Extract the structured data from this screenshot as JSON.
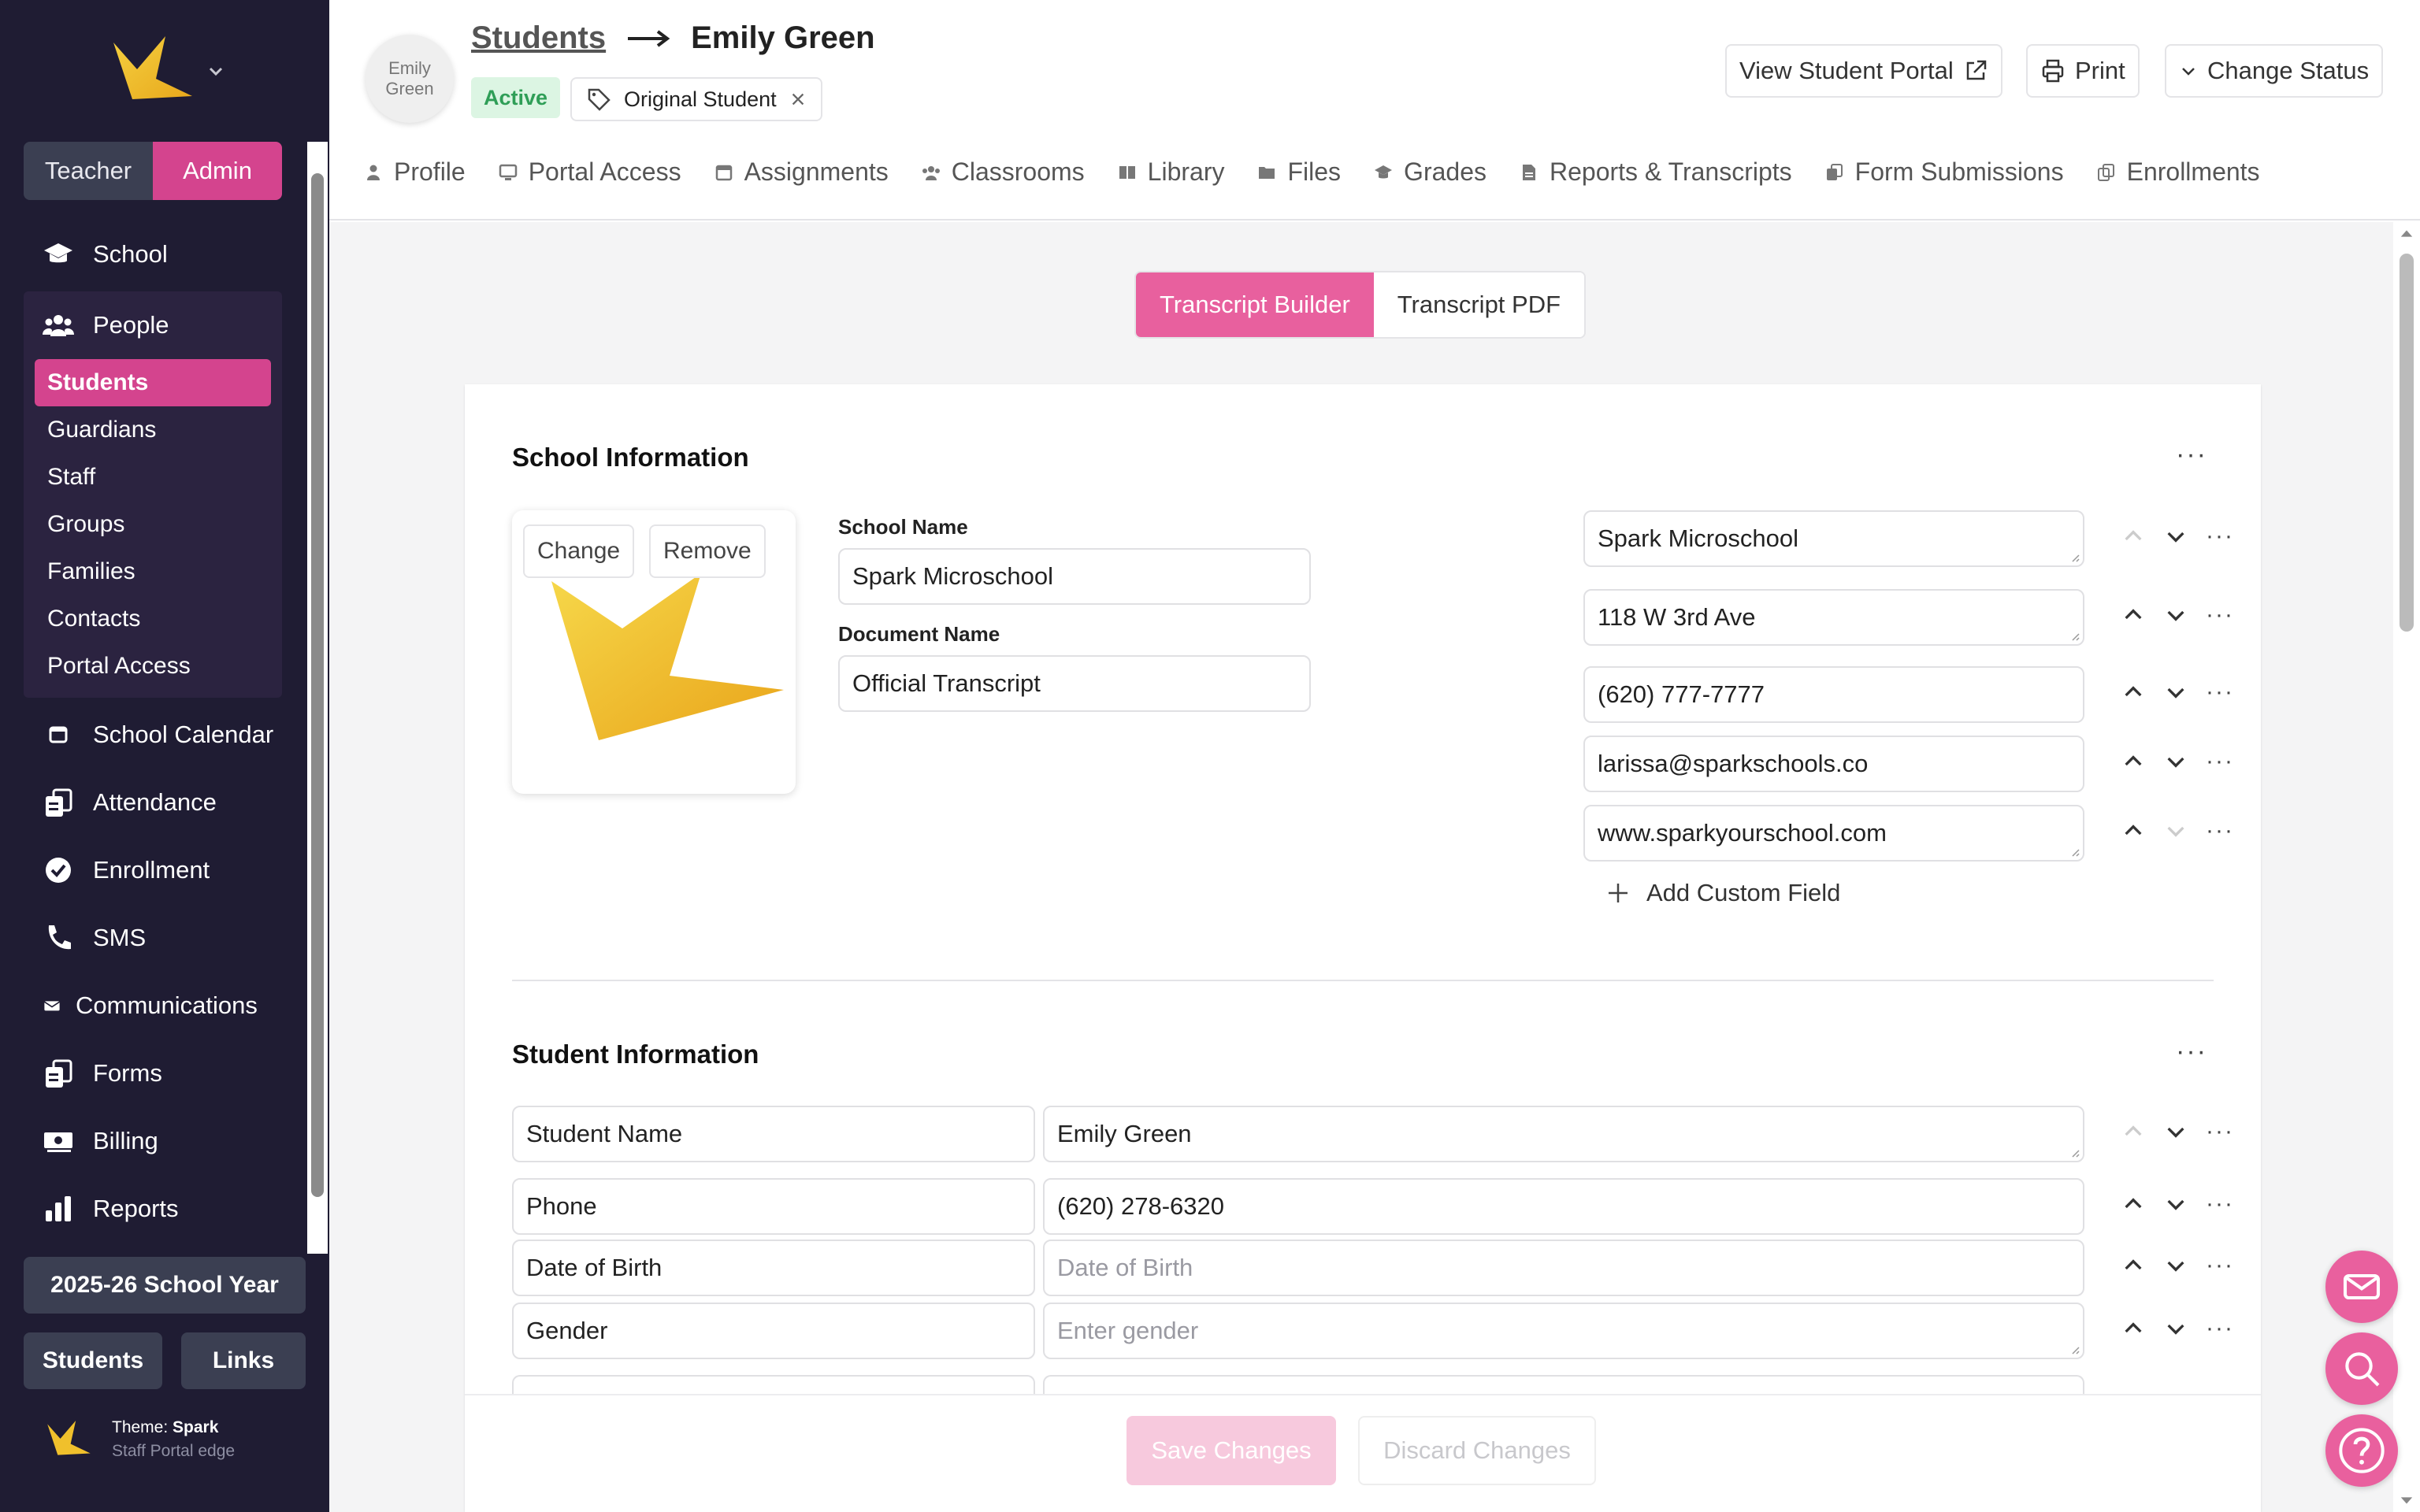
{
  "sidebar": {
    "roles": {
      "teacher": "Teacher",
      "admin": "Admin"
    },
    "nav": {
      "school": "School",
      "people": "People",
      "people_sub": [
        "Students",
        "Guardians",
        "Staff",
        "Groups",
        "Families",
        "Contacts",
        "Portal Access"
      ],
      "school_calendar": "School Calendar",
      "attendance": "Attendance",
      "enrollment": "Enrollment",
      "sms": "SMS",
      "communications": "Communications",
      "forms": "Forms",
      "billing": "Billing",
      "reports": "Reports"
    },
    "school_year": "2025-26 School Year",
    "quick_links": {
      "students": "Students",
      "links": "Links"
    },
    "theme": {
      "label": "Theme:",
      "name": "Spark",
      "sub": "Staff Portal edge"
    }
  },
  "header": {
    "avatar_text": "Emily Green",
    "breadcrumb_parent": "Students",
    "student_name": "Emily Green",
    "status_badge": "Active",
    "tag": "Original Student",
    "view_portal": "View Student Portal",
    "print": "Print",
    "change_status": "Change Status"
  },
  "tabs": [
    "Profile",
    "Portal Access",
    "Assignments",
    "Classrooms",
    "Library",
    "Files",
    "Grades",
    "Reports & Transcripts",
    "Form Submissions",
    "Enrollments"
  ],
  "segment": {
    "builder": "Transcript Builder",
    "pdf": "Transcript PDF"
  },
  "school_info": {
    "title": "School Information",
    "change": "Change",
    "remove": "Remove",
    "school_name_label": "School Name",
    "school_name": "Spark Microschool",
    "document_name_label": "Document Name",
    "document_name": "Official Transcript",
    "fields": [
      "Spark Microschool",
      "118 W 3rd Ave",
      "(620) 777-7777",
      "larissa@sparkschools.co",
      "www.sparkyourschool.com"
    ],
    "add_custom_field": "Add Custom Field"
  },
  "student_info": {
    "title": "Student Information",
    "rows": [
      {
        "label": "Student Name",
        "value": "Emily Green",
        "placeholder": ""
      },
      {
        "label": "Phone",
        "value": "(620) 278-6320",
        "placeholder": ""
      },
      {
        "label": "Date of Birth",
        "value": "",
        "placeholder": "Date of Birth"
      },
      {
        "label": "Gender",
        "value": "",
        "placeholder": "Enter gender"
      }
    ]
  },
  "footer": {
    "save": "Save Changes",
    "discard": "Discard Changes"
  },
  "colors": {
    "sidebar_bg": "#1f1c33",
    "accent": "#d4448e",
    "accent_light": "#e8609e",
    "active_badge": "#2f9e57"
  }
}
